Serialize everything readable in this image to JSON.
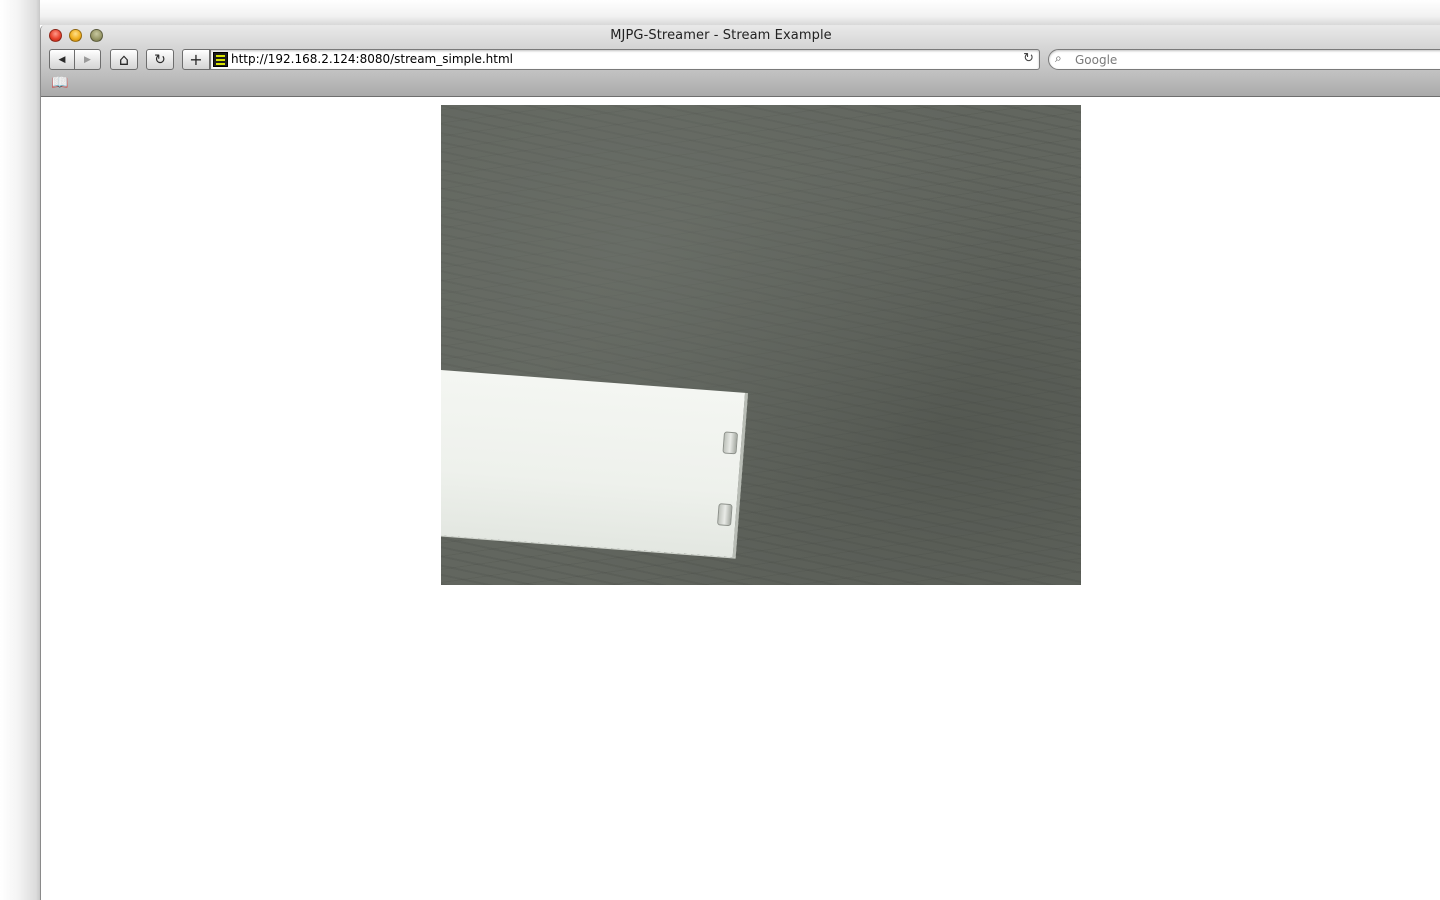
{
  "window": {
    "title": "MJPG-Streamer - Stream Example"
  },
  "toolbar": {
    "back_glyph": "◀",
    "forward_glyph": "▶",
    "home_glyph": "⌂",
    "reload_glyph": "↻",
    "add_bookmark_glyph": "+",
    "url": "http://192.168.2.124:8080/stream_simple.html",
    "url_reload_glyph": "↻",
    "search_placeholder": "Google",
    "search_icon_glyph": "⌕"
  },
  "bookmarks_bar": {
    "bookmarks_glyph": "📖"
  },
  "colors": {
    "favicon_accent": "#d8e400",
    "close": "#e8432e",
    "minimize": "#f0b021",
    "zoom": "#9a9a6a"
  },
  "icons": [
    "back-arrow-icon",
    "forward-arrow-icon",
    "home-icon",
    "reload-icon",
    "add-bookmark-icon",
    "favicon-icon",
    "search-icon",
    "bookmarks-icon"
  ]
}
